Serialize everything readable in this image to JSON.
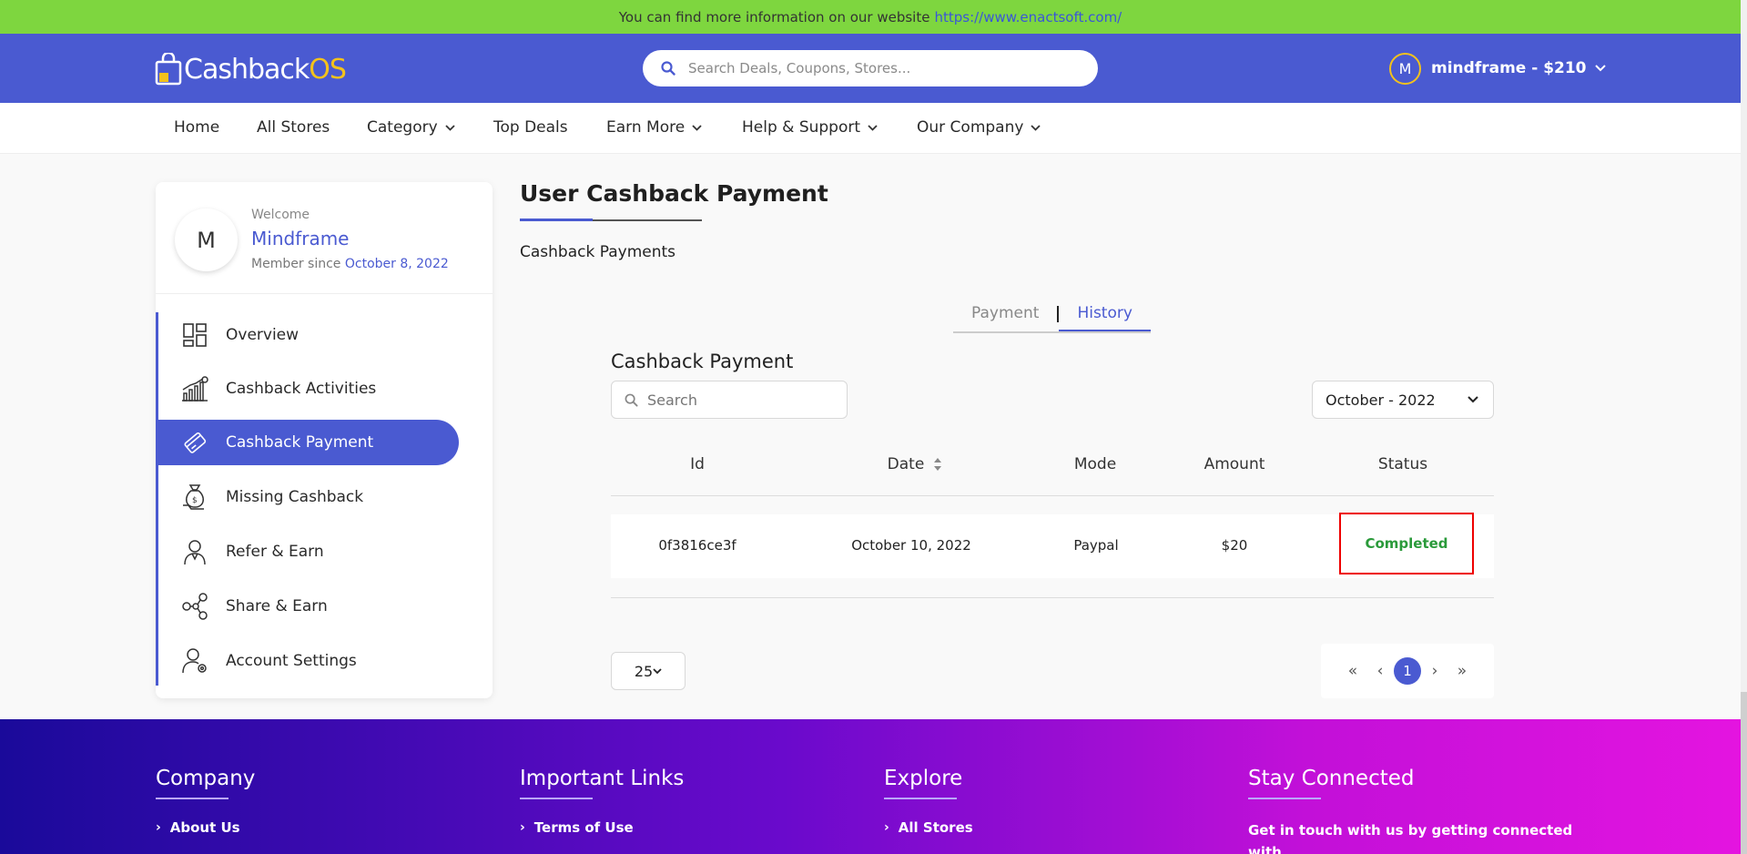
{
  "topbar": {
    "text": "You can find more information on our website",
    "link": "https://www.enactsoft.com/"
  },
  "header": {
    "logo_main": "Cashback",
    "logo_accent": "OS",
    "search_placeholder": "Search Deals, Coupons, Stores...",
    "user_initial": "M",
    "user_label": "mindframe - $210"
  },
  "nav": [
    {
      "label": "Home",
      "dropdown": false
    },
    {
      "label": "All Stores",
      "dropdown": false
    },
    {
      "label": "Category",
      "dropdown": true
    },
    {
      "label": "Top Deals",
      "dropdown": false
    },
    {
      "label": "Earn More",
      "dropdown": true
    },
    {
      "label": "Help & Support",
      "dropdown": true
    },
    {
      "label": "Our Company",
      "dropdown": true
    }
  ],
  "profile": {
    "initial": "M",
    "welcome": "Welcome",
    "name": "Mindframe",
    "since_label": "Member since",
    "since_date": "October 8, 2022"
  },
  "sidebar": [
    {
      "label": "Overview",
      "icon": "overview-icon",
      "active": false
    },
    {
      "label": "Cashback Activities",
      "icon": "chart-icon",
      "active": false
    },
    {
      "label": "Cashback Payment",
      "icon": "card-icon",
      "active": true
    },
    {
      "label": "Missing Cashback",
      "icon": "money-bag-icon",
      "active": false
    },
    {
      "label": "Refer & Earn",
      "icon": "user-icon",
      "active": false
    },
    {
      "label": "Share & Earn",
      "icon": "share-icon",
      "active": false
    },
    {
      "label": "Account Settings",
      "icon": "user-gear-icon",
      "active": false
    }
  ],
  "main": {
    "title": "User Cashback Payment",
    "subtitle": "Cashback Payments",
    "tabs": [
      {
        "label": "Payment",
        "active": false
      },
      {
        "label": "History",
        "active": true
      }
    ],
    "section_title": "Cashback Payment",
    "search_placeholder": "Search",
    "month": "October - 2022",
    "columns": [
      "Id",
      "Date",
      "Mode",
      "Amount",
      "Status"
    ],
    "rows": [
      {
        "id": "0f3816ce3f",
        "date": "October 10, 2022",
        "mode": "Paypal",
        "amount": "$20",
        "status": "Completed"
      }
    ],
    "per_page": "25",
    "pager": {
      "first": "«",
      "prev": "‹",
      "current": "1",
      "next": "›",
      "last": "»"
    }
  },
  "footer": {
    "company": {
      "title": "Company",
      "link": "About Us"
    },
    "links": {
      "title": "Important Links",
      "link": "Terms of Use"
    },
    "explore": {
      "title": "Explore",
      "link": "All Stores"
    },
    "connected": {
      "title": "Stay Connected",
      "text": "Get in touch with us by getting connected with"
    }
  },
  "colors": {
    "brand": "#4a5ad1",
    "accent": "#f3c21c",
    "topbar": "#7ed63f",
    "success": "#2a9a3a"
  }
}
